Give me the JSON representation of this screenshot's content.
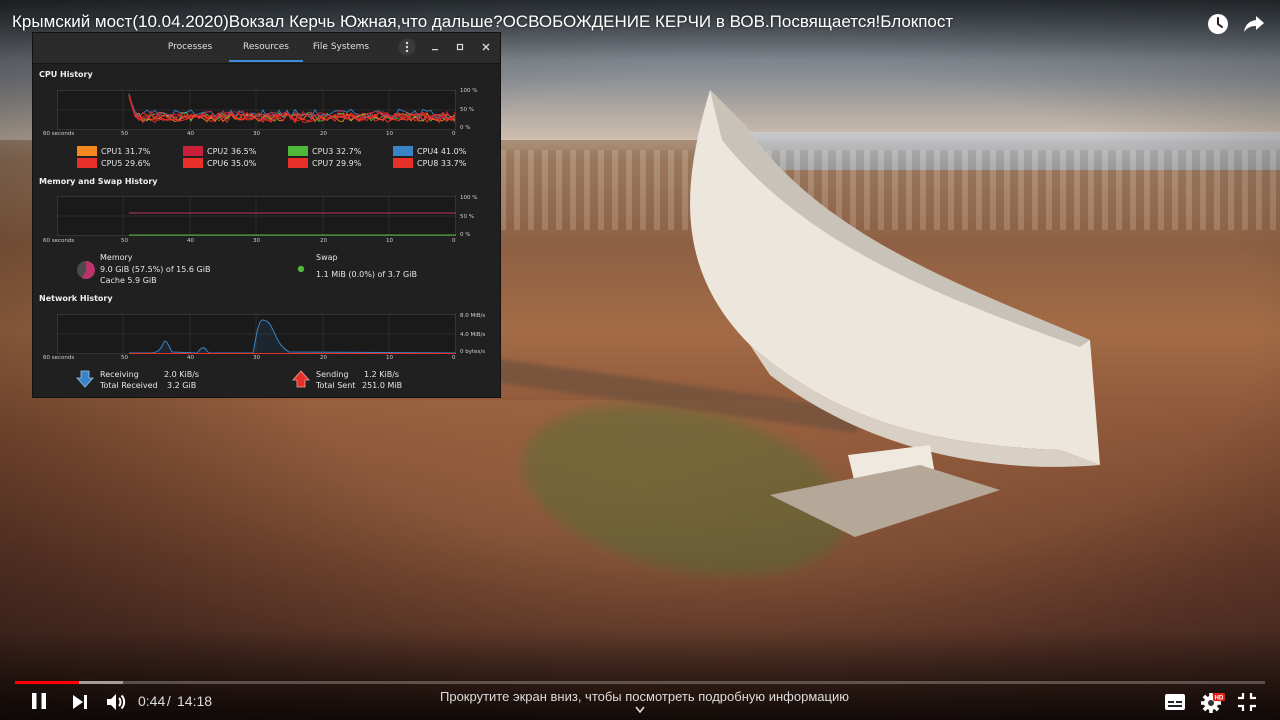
{
  "video": {
    "title": "Крымский мост(10.04.2020)Вокзал Керчь Южная,что дальше?ОСВОБОЖДЕНИЕ КЕРЧИ в ВОВ.Посвящается!Блокпост",
    "top_icons": [
      "watch-later-icon",
      "share-icon"
    ]
  },
  "sysmon": {
    "tabs": [
      {
        "label": "Processes",
        "active": false
      },
      {
        "label": "Resources",
        "active": true
      },
      {
        "label": "File Systems",
        "active": false
      }
    ],
    "header_icons": [
      "menu-icon",
      "minimize-icon",
      "maximize-icon",
      "close-icon"
    ],
    "cpu": {
      "title": "CPU History",
      "y_labels": [
        "100 %",
        "50 %",
        "0 %"
      ],
      "x_labels": [
        "60 seconds",
        "50",
        "40",
        "30",
        "20",
        "10",
        "0"
      ],
      "cores": [
        {
          "label": "CPU1",
          "value": "31.7%",
          "color": "#f5871f"
        },
        {
          "label": "CPU2",
          "value": "36.5%",
          "color": "#c8203a"
        },
        {
          "label": "CPU3",
          "value": "32.7%",
          "color": "#4fb83a"
        },
        {
          "label": "CPU4",
          "value": "41.0%",
          "color": "#3a83c4"
        },
        {
          "label": "CPU5",
          "value": "29.6%",
          "color": "#e8302a"
        },
        {
          "label": "CPU6",
          "value": "35.0%",
          "color": "#e8302a"
        },
        {
          "label": "CPU7",
          "value": "29.9%",
          "color": "#e8302a"
        },
        {
          "label": "CPU8",
          "value": "33.7%",
          "color": "#e8302a"
        }
      ]
    },
    "memory": {
      "title": "Memory and Swap History",
      "y_labels": [
        "100 %",
        "50 %",
        "0 %"
      ],
      "x_labels": [
        "60 seconds",
        "50",
        "40",
        "30",
        "20",
        "10",
        "0"
      ],
      "memory_label": "Memory",
      "memory_value": "9.0 GiB (57.5%) of 15.6 GiB",
      "memory_fraction": 0.575,
      "cache": "Cache 5.9 GiB",
      "memory_color": "#b8346a",
      "swap_label": "Swap",
      "swap_value": "1.1 MiB (0.0%) of 3.7 GiB",
      "swap_color": "#4fb83a"
    },
    "network": {
      "title": "Network History",
      "y_labels": [
        "8.0 MiB/s",
        "4.0 MiB/s",
        "0 bytes/s"
      ],
      "x_labels": [
        "60 seconds",
        "50",
        "40",
        "30",
        "20",
        "10",
        "0"
      ],
      "receiving_label": "Receiving",
      "receiving_value": "2.0 KiB/s",
      "total_received_label": "Total Received",
      "total_received_value": "3.2 GiB",
      "sending_label": "Sending",
      "sending_value": "1.2 KiB/s",
      "total_sent_label": "Total Sent",
      "total_sent_value": "251.0 MiB",
      "receiving_color": "#3a83c4",
      "sending_color": "#e8302a"
    }
  },
  "player": {
    "current_time": "0:44",
    "separator": " / ",
    "total_time": "14:18",
    "progress_fraction": 0.051,
    "scroll_hint": "Прокрутите экран вниз, чтобы посмотреть подробную информацию",
    "hd_badge": "HD",
    "icons": [
      "pause-icon",
      "next-icon",
      "volume-icon",
      "subtitles-icon",
      "settings-icon",
      "exit-fullscreen-icon",
      "chevron-down-icon"
    ]
  }
}
